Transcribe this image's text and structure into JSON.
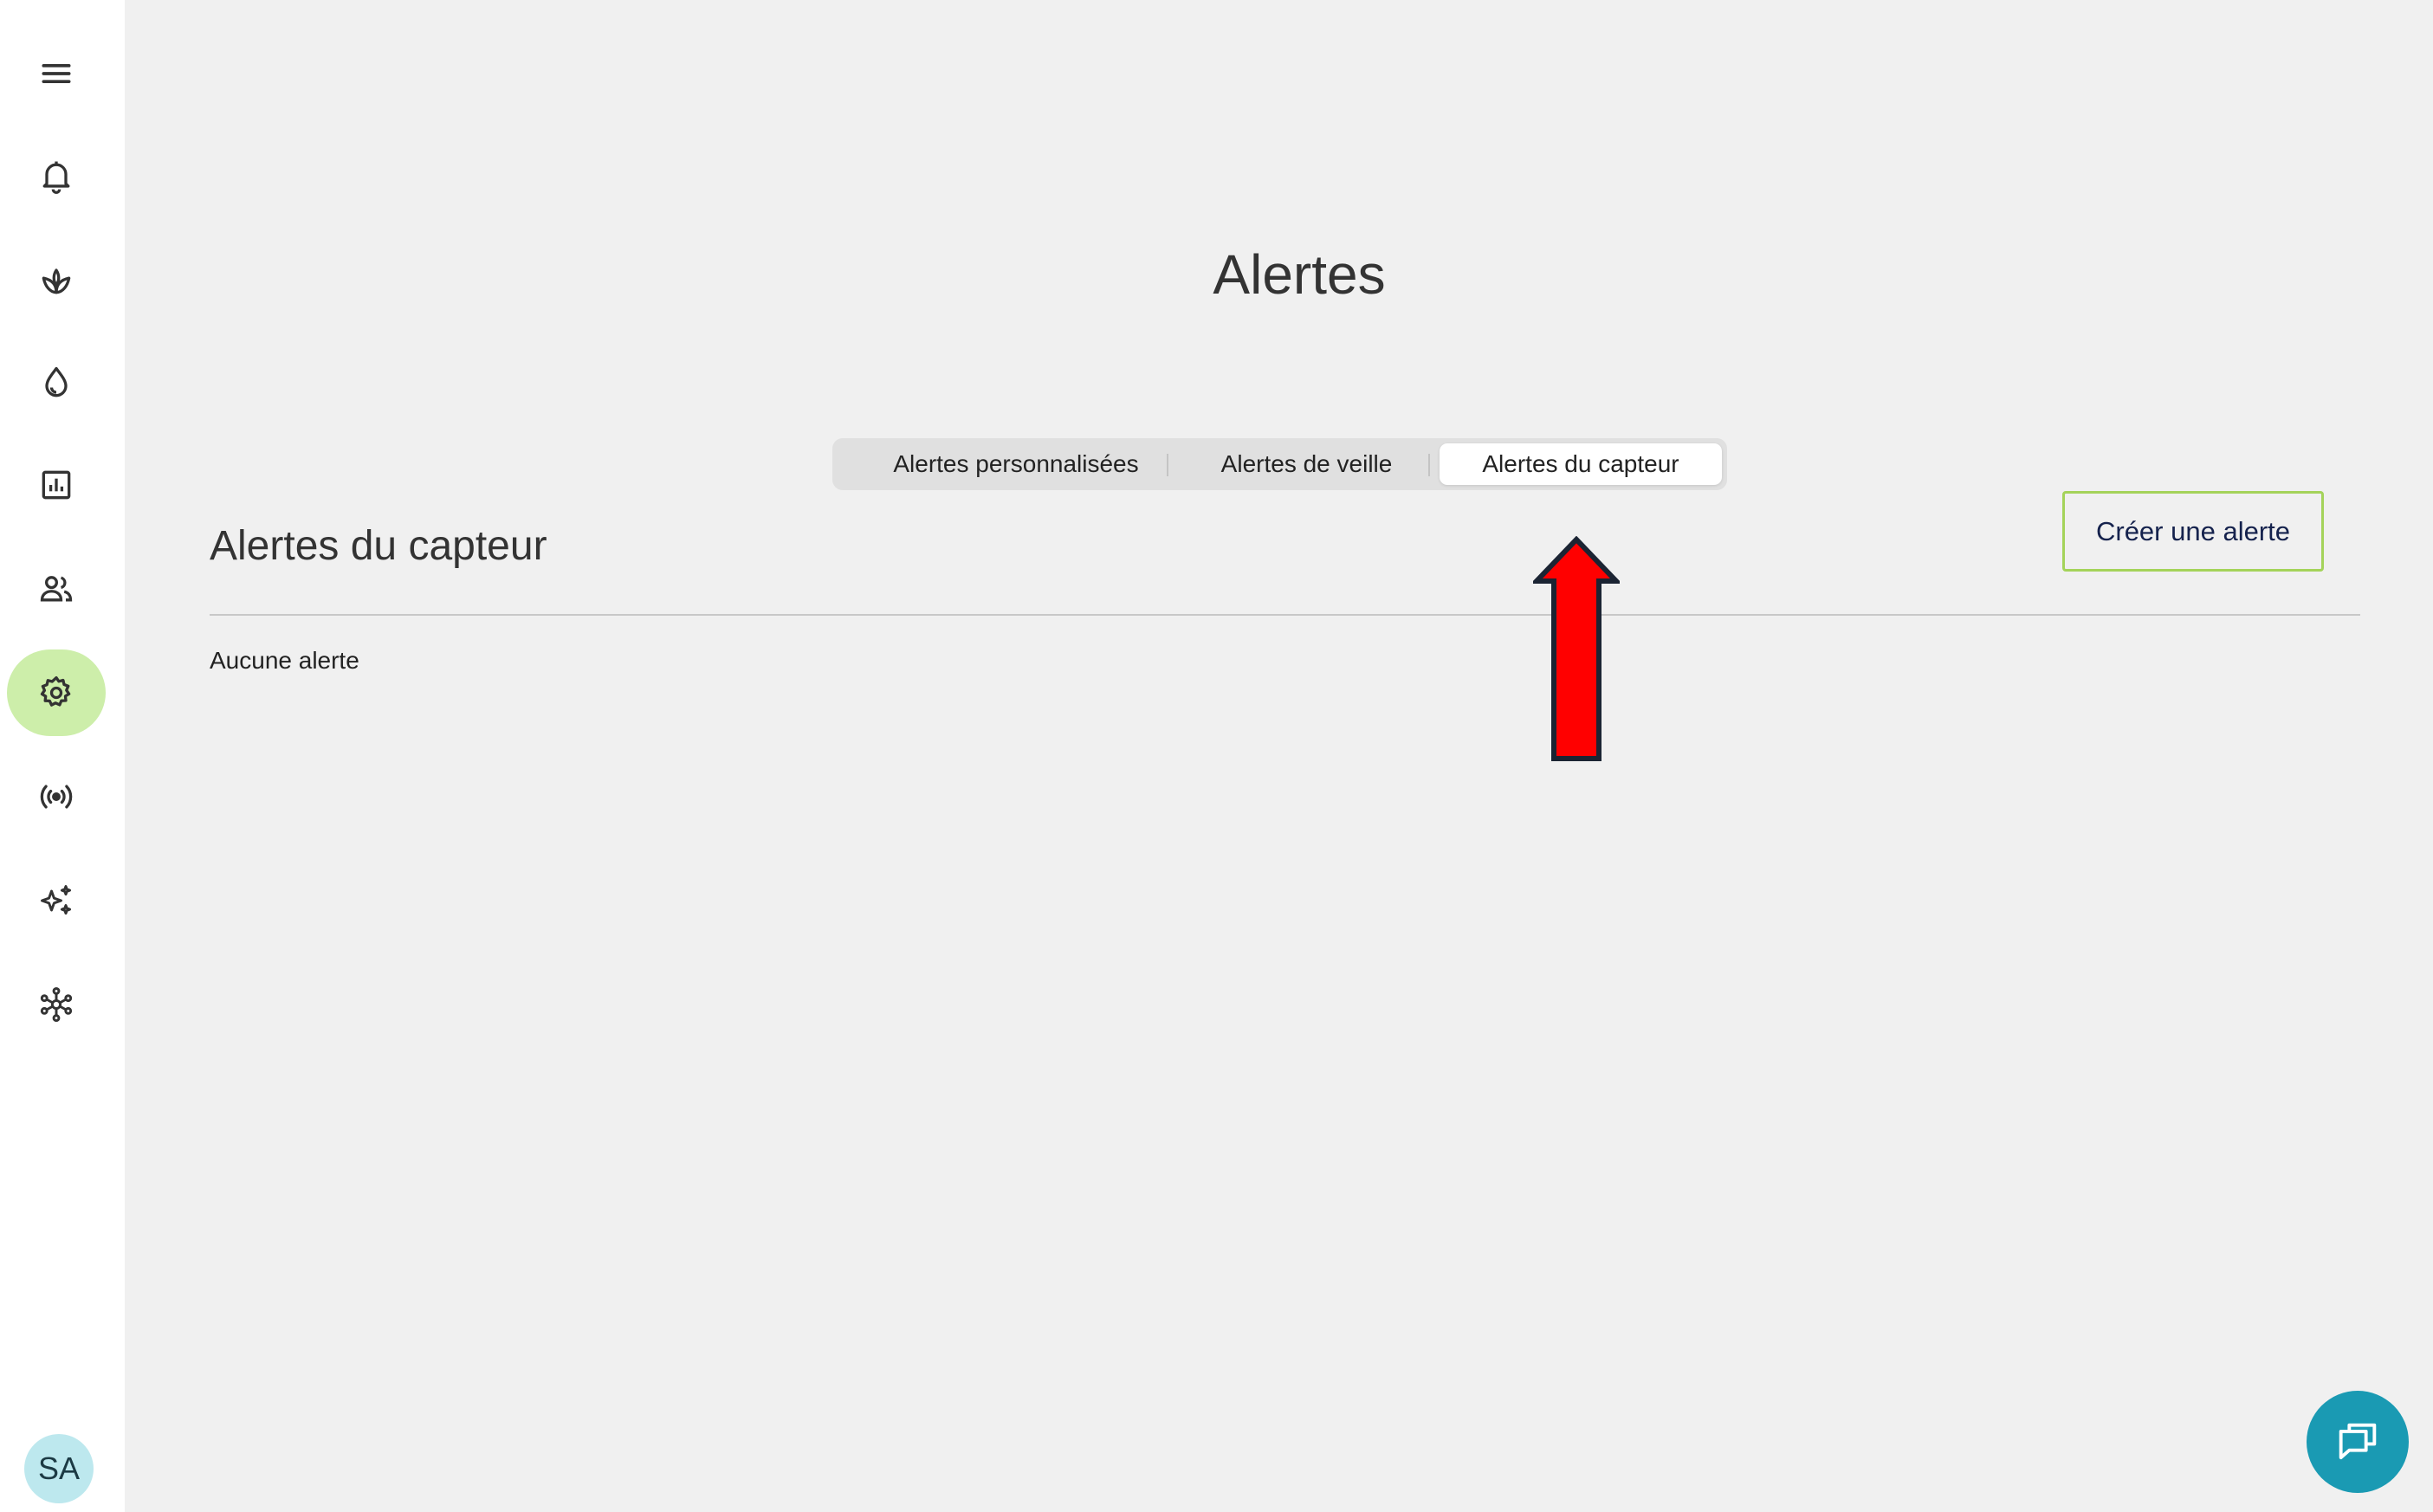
{
  "sidebar": {
    "items": [
      {
        "name": "menu-icon"
      },
      {
        "name": "bell-icon"
      },
      {
        "name": "plant-icon"
      },
      {
        "name": "water-drop-icon"
      },
      {
        "name": "bar-chart-icon"
      },
      {
        "name": "users-icon"
      },
      {
        "name": "gear-icon",
        "active": true
      },
      {
        "name": "signal-icon"
      },
      {
        "name": "sparkle-icon"
      },
      {
        "name": "network-icon"
      }
    ],
    "avatar_initials": "SA",
    "active_color": "#cdeeaa"
  },
  "main": {
    "title": "Alertes",
    "tabs": [
      {
        "label": "Alertes personnalisées"
      },
      {
        "label": "Alertes de veille"
      },
      {
        "label": "Alertes du capteur",
        "active": true
      }
    ],
    "section_title": "Alertes du capteur",
    "create_button_label": "Créer une alerte",
    "empty_message": "Aucune alerte"
  },
  "annotation": {
    "arrow_color": "#ff0000"
  },
  "chat": {
    "icon": "chat-icon",
    "color": "#1a9ab3"
  }
}
